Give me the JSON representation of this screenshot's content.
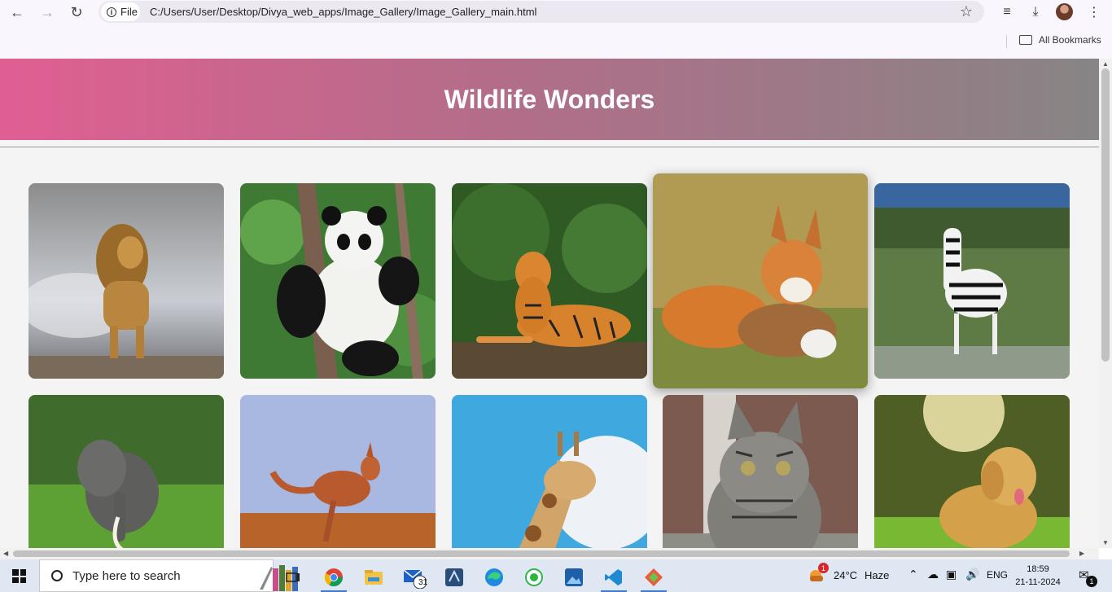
{
  "browser": {
    "site_chip_label": "File",
    "url": "C:/Users/User/Desktop/Divya_web_apps/Image_Gallery/Image_Gallery_main.html",
    "bookmarks_label": "All Bookmarks"
  },
  "page": {
    "title": "Wildlife Wonders",
    "gallery": [
      {
        "animal": "lion"
      },
      {
        "animal": "panda"
      },
      {
        "animal": "tiger"
      },
      {
        "animal": "fox",
        "hovered": true
      },
      {
        "animal": "zebra"
      },
      {
        "animal": "elephant"
      },
      {
        "animal": "kangaroo"
      },
      {
        "animal": "giraffe"
      },
      {
        "animal": "cat"
      },
      {
        "animal": "golden retriever"
      }
    ]
  },
  "taskbar": {
    "search_placeholder": "Type here to search",
    "mail_badge": "31",
    "weather_badge": "1",
    "temperature": "24°C",
    "weather": "Haze",
    "language": "ENG",
    "time": "18:59",
    "date": "21-11-2024",
    "notification_count": "1"
  },
  "colors": {
    "header_start": "#e05f92",
    "header_end": "#878585",
    "taskbar": "#dfe7f3"
  }
}
